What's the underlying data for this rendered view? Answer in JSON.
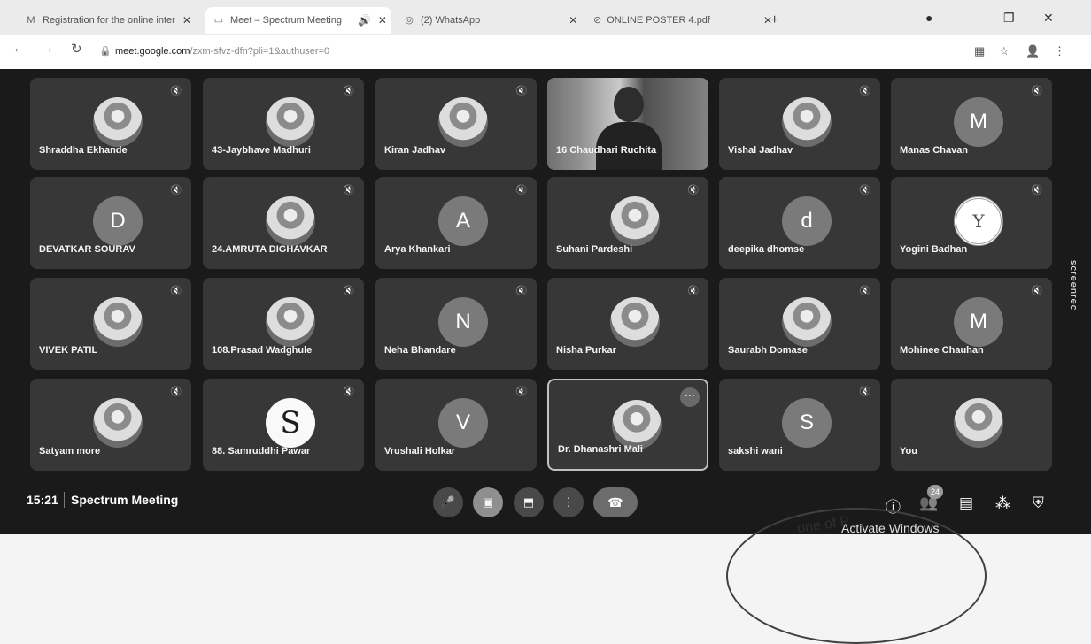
{
  "tabs": [
    {
      "label": "Registration for the online inter",
      "icon": "gmail-icon"
    },
    {
      "label": "Meet – Spectrum Meeting",
      "icon": "meet-icon",
      "active": true
    },
    {
      "label": "(2) WhatsApp",
      "icon": "whatsapp-icon"
    },
    {
      "label": "ONLINE POSTER 4.pdf",
      "icon": "pdf-icon"
    }
  ],
  "address": {
    "host": "meet.google.com",
    "path": "/zxm-sfvz-dfn?pli=1&authuser=0"
  },
  "participants": [
    {
      "name": "Shraddha Ekhande",
      "avatar": "photo"
    },
    {
      "name": "43-Jaybhave Madhuri",
      "avatar": "photo"
    },
    {
      "name": "Kiran Jadhav",
      "avatar": "photo"
    },
    {
      "name": "16 Chaudhari Ruchita",
      "avatar": "camera"
    },
    {
      "name": "Vishal Jadhav",
      "avatar": "photo"
    },
    {
      "name": "Manas Chavan",
      "avatar": "M"
    },
    {
      "name": "DEVATKAR SOURAV",
      "avatar": "D"
    },
    {
      "name": "24.AMRUTA DIGHAVKAR",
      "avatar": "photo"
    },
    {
      "name": "Arya Khankari",
      "avatar": "A"
    },
    {
      "name": "Suhani Pardeshi",
      "avatar": "photo"
    },
    {
      "name": "deepika dhomse",
      "avatar": "d"
    },
    {
      "name": "Yogini Badhan",
      "avatar": "Y"
    },
    {
      "name": "VIVEK PATIL",
      "avatar": "photo"
    },
    {
      "name": "108.Prasad Wadghule",
      "avatar": "photo"
    },
    {
      "name": "Neha Bhandare",
      "avatar": "N"
    },
    {
      "name": "Nisha Purkar",
      "avatar": "photo"
    },
    {
      "name": "Saurabh Domase",
      "avatar": "photo"
    },
    {
      "name": "Mohinee Chauhan",
      "avatar": "M"
    },
    {
      "name": "Satyam more",
      "avatar": "photo"
    },
    {
      "name": "88. Samruddhi Pawar",
      "avatar": "S"
    },
    {
      "name": "Vrushali Holkar",
      "avatar": "V"
    },
    {
      "name": "Dr. Dhanashri Mali",
      "avatar": "photo"
    },
    {
      "name": "sakshi wani",
      "avatar": "S"
    },
    {
      "name": "You",
      "avatar": "photo"
    }
  ],
  "meeting": {
    "time": "15:21",
    "name": "Spectrum Meeting",
    "participant_count": "24"
  },
  "overlay": {
    "screenrec": "screenrec",
    "activate": "Activate Windows",
    "stamp": "one of P"
  }
}
